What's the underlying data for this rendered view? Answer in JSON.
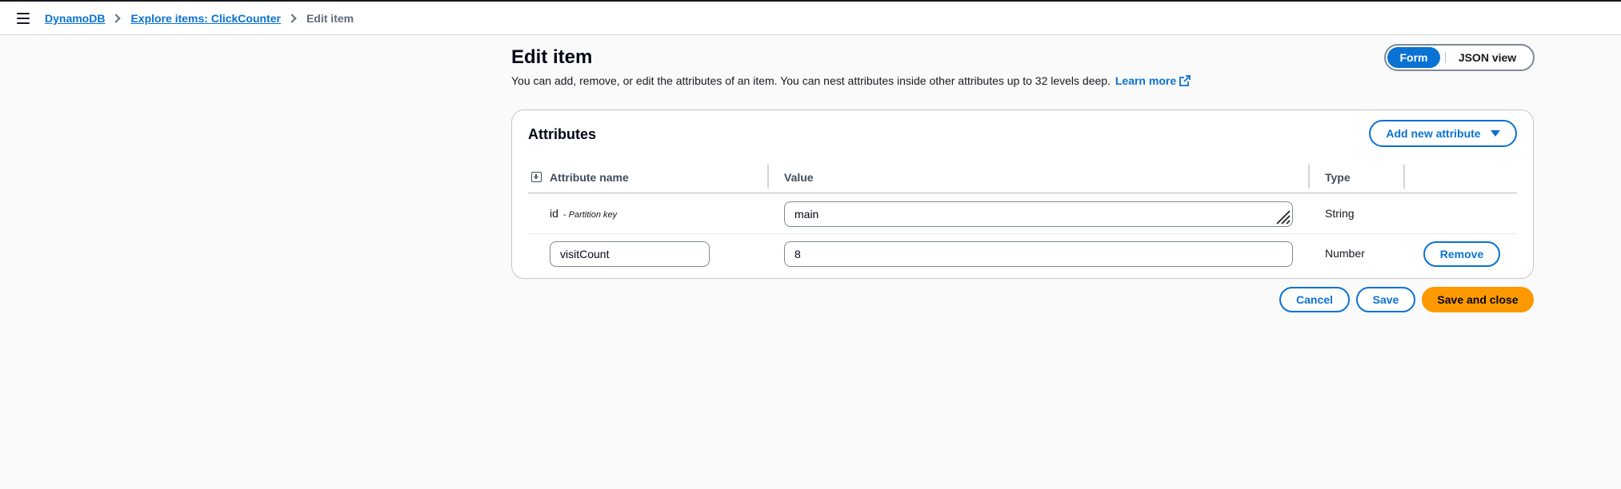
{
  "breadcrumb": {
    "items": [
      {
        "label": "DynamoDB"
      },
      {
        "label": "Explore items: ClickCounter"
      }
    ],
    "current": "Edit item"
  },
  "page": {
    "title": "Edit item",
    "description": "You can add, remove, or edit the attributes of an item. You can nest attributes inside other attributes up to 32 levels deep.",
    "learn_more": "Learn more"
  },
  "view_toggle": {
    "options": [
      "Form",
      "JSON view"
    ],
    "selected": "Form"
  },
  "attributes": {
    "title": "Attributes",
    "add_button": "Add new attribute",
    "columns": [
      "Attribute name",
      "Value",
      "Type"
    ],
    "rows": [
      {
        "name": "id",
        "note": "- Partition key",
        "value": "main",
        "type": "String"
      },
      {
        "name": "visitCount",
        "value": "8",
        "type": "Number",
        "action": "Remove"
      }
    ]
  },
  "footer": {
    "cancel": "Cancel",
    "save": "Save",
    "save_close": "Save and close"
  },
  "colors": {
    "accent": "#0972d3",
    "primary_button": "#ff9900"
  },
  "icons": [
    "menu-icon",
    "chevron-right-icon",
    "external-link-icon",
    "expand-all-icon",
    "caret-down-icon",
    "resize-grip-icon"
  ]
}
